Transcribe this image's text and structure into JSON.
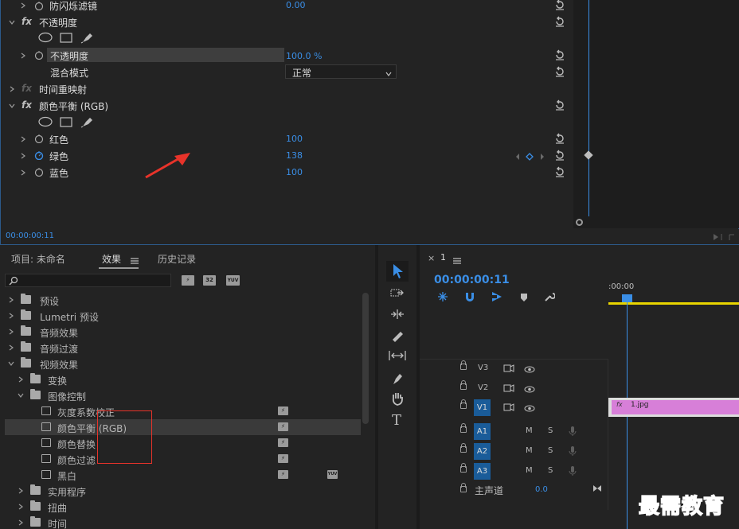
{
  "effect_controls": {
    "rows": [
      {
        "label": "防闪烁滤镜",
        "value": "0.00"
      },
      {
        "label": "不透明度"
      },
      {
        "label": "不透明度",
        "value": "100.0 %"
      },
      {
        "label": "混合模式",
        "value": "正常"
      },
      {
        "label": "时间重映射"
      },
      {
        "label": "颜色平衡 (RGB)"
      },
      {
        "label": "红色",
        "value": "100"
      },
      {
        "label": "绿色",
        "value": "138"
      },
      {
        "label": "蓝色",
        "value": "100"
      }
    ],
    "fx_label": "fx",
    "timecode": "00:00:00:11"
  },
  "effects_panel": {
    "tabs": [
      "项目: 未命名",
      "效果",
      "历史记录"
    ],
    "search_placeholder": "",
    "filter_badges": [
      "32",
      "YUV"
    ],
    "tree": [
      {
        "label": "预设"
      },
      {
        "label": "Lumetri 预设"
      },
      {
        "label": "音频效果"
      },
      {
        "label": "音频过渡"
      },
      {
        "label": "视频效果"
      },
      {
        "label": "变换"
      },
      {
        "label": "图像控制"
      },
      {
        "label": "灰度系数校正"
      },
      {
        "label": "颜色平衡 (RGB)"
      },
      {
        "label": "颜色替换"
      },
      {
        "label": "颜色过滤"
      },
      {
        "label": "黑白"
      },
      {
        "label": "实用程序"
      },
      {
        "label": "扭曲"
      },
      {
        "label": "时间"
      }
    ]
  },
  "timeline": {
    "tab_label": "1",
    "timecode": "00:00:00:11",
    "ruler_start": ":00:00",
    "tracks": [
      {
        "name": "V3"
      },
      {
        "name": "V2"
      },
      {
        "name": "V1"
      },
      {
        "name": "A1",
        "m": "M",
        "s": "S"
      },
      {
        "name": "A2",
        "m": "M",
        "s": "S"
      },
      {
        "name": "A3",
        "m": "M",
        "s": "S"
      }
    ],
    "master_label": "主声道",
    "master_value": "0.0",
    "clip_name": "1.jpg",
    "clip_fx": "fx"
  },
  "tools": {
    "type_tool": "T"
  },
  "watermark": "最需教育",
  "colors": {
    "accent": "#3a8ee6",
    "playhead": "#3a8ee6",
    "clip": "#d77fd8",
    "track_on": "#1a5c99",
    "arrow": "#e8332a",
    "watermark": "#1f3fa0"
  }
}
